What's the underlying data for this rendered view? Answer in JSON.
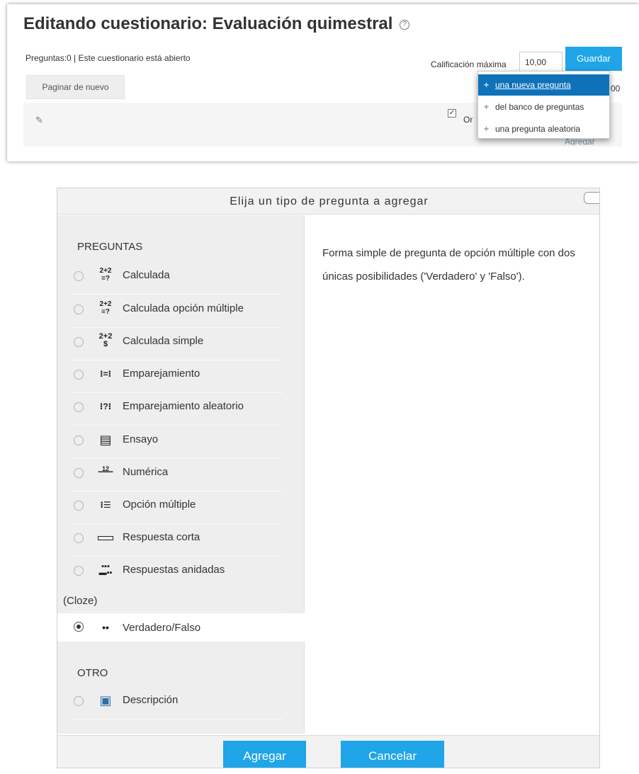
{
  "page": {
    "title": "Editando cuestionario: Evaluación quimestral",
    "help_icon": "question-circle-icon",
    "status": "Preguntas:0 | Este cuestionario está abierto",
    "repaginate_label": "Paginar de nuevo",
    "max_grade_label": "Calificación máxima",
    "max_grade_value": "10,00",
    "save_label": "Guardar",
    "partial_checkbox_text": "Or",
    "partial_grade_text": "00",
    "partial_add_text": "Agregar"
  },
  "add_menu": {
    "items": [
      {
        "label": "una nueva pregunta",
        "active": true,
        "icon": "plus-icon"
      },
      {
        "label": "del banco de preguntas",
        "active": false,
        "icon": "plus-icon"
      },
      {
        "label": "una pregunta aleatoria",
        "active": false,
        "icon": "plus-icon"
      }
    ]
  },
  "dialog": {
    "title": "Elija un tipo de pregunta a agregar",
    "section_questions": "PREGUNTAS",
    "section_other": "OTRO",
    "question_types": [
      {
        "label": "Calculada",
        "icon": "calculated-icon",
        "glyph": "²⁺²₌?"
      },
      {
        "label": "Calculada opción múltiple",
        "icon": "calculated-multichoice-icon",
        "glyph": "²⁺²"
      },
      {
        "label": "Calculada simple",
        "icon": "calculated-simple-icon",
        "glyph": "²⁺$"
      },
      {
        "label": "Emparejamiento",
        "icon": "matching-icon",
        "glyph": "⁞⁚⁞"
      },
      {
        "label": "Emparejamiento aleatorio",
        "icon": "random-matching-icon",
        "glyph": "⁞?⁞"
      },
      {
        "label": "Ensayo",
        "icon": "essay-icon",
        "glyph": "▤"
      },
      {
        "label": "Numérica",
        "icon": "numerical-icon",
        "glyph": "¹²"
      },
      {
        "label": "Opción múltiple",
        "icon": "multichoice-icon",
        "glyph": "⁞☰"
      },
      {
        "label": "Respuesta corta",
        "icon": "short-answer-icon",
        "glyph": "▭"
      },
      {
        "label": "Respuestas anidadas",
        "label_line2": "(Cloze)",
        "icon": "cloze-icon",
        "glyph": "▦"
      },
      {
        "label": "Verdadero/Falso",
        "icon": "true-false-icon",
        "glyph": "••",
        "selected": true
      }
    ],
    "other_types": [
      {
        "label": "Descripción",
        "icon": "description-icon",
        "glyph": "▣"
      }
    ],
    "description": "Forma simple de pregunta de opción múltiple con dos únicas posibilidades ('Verdadero' y 'Falso').",
    "add_label": "Agregar",
    "cancel_label": "Cancelar"
  }
}
